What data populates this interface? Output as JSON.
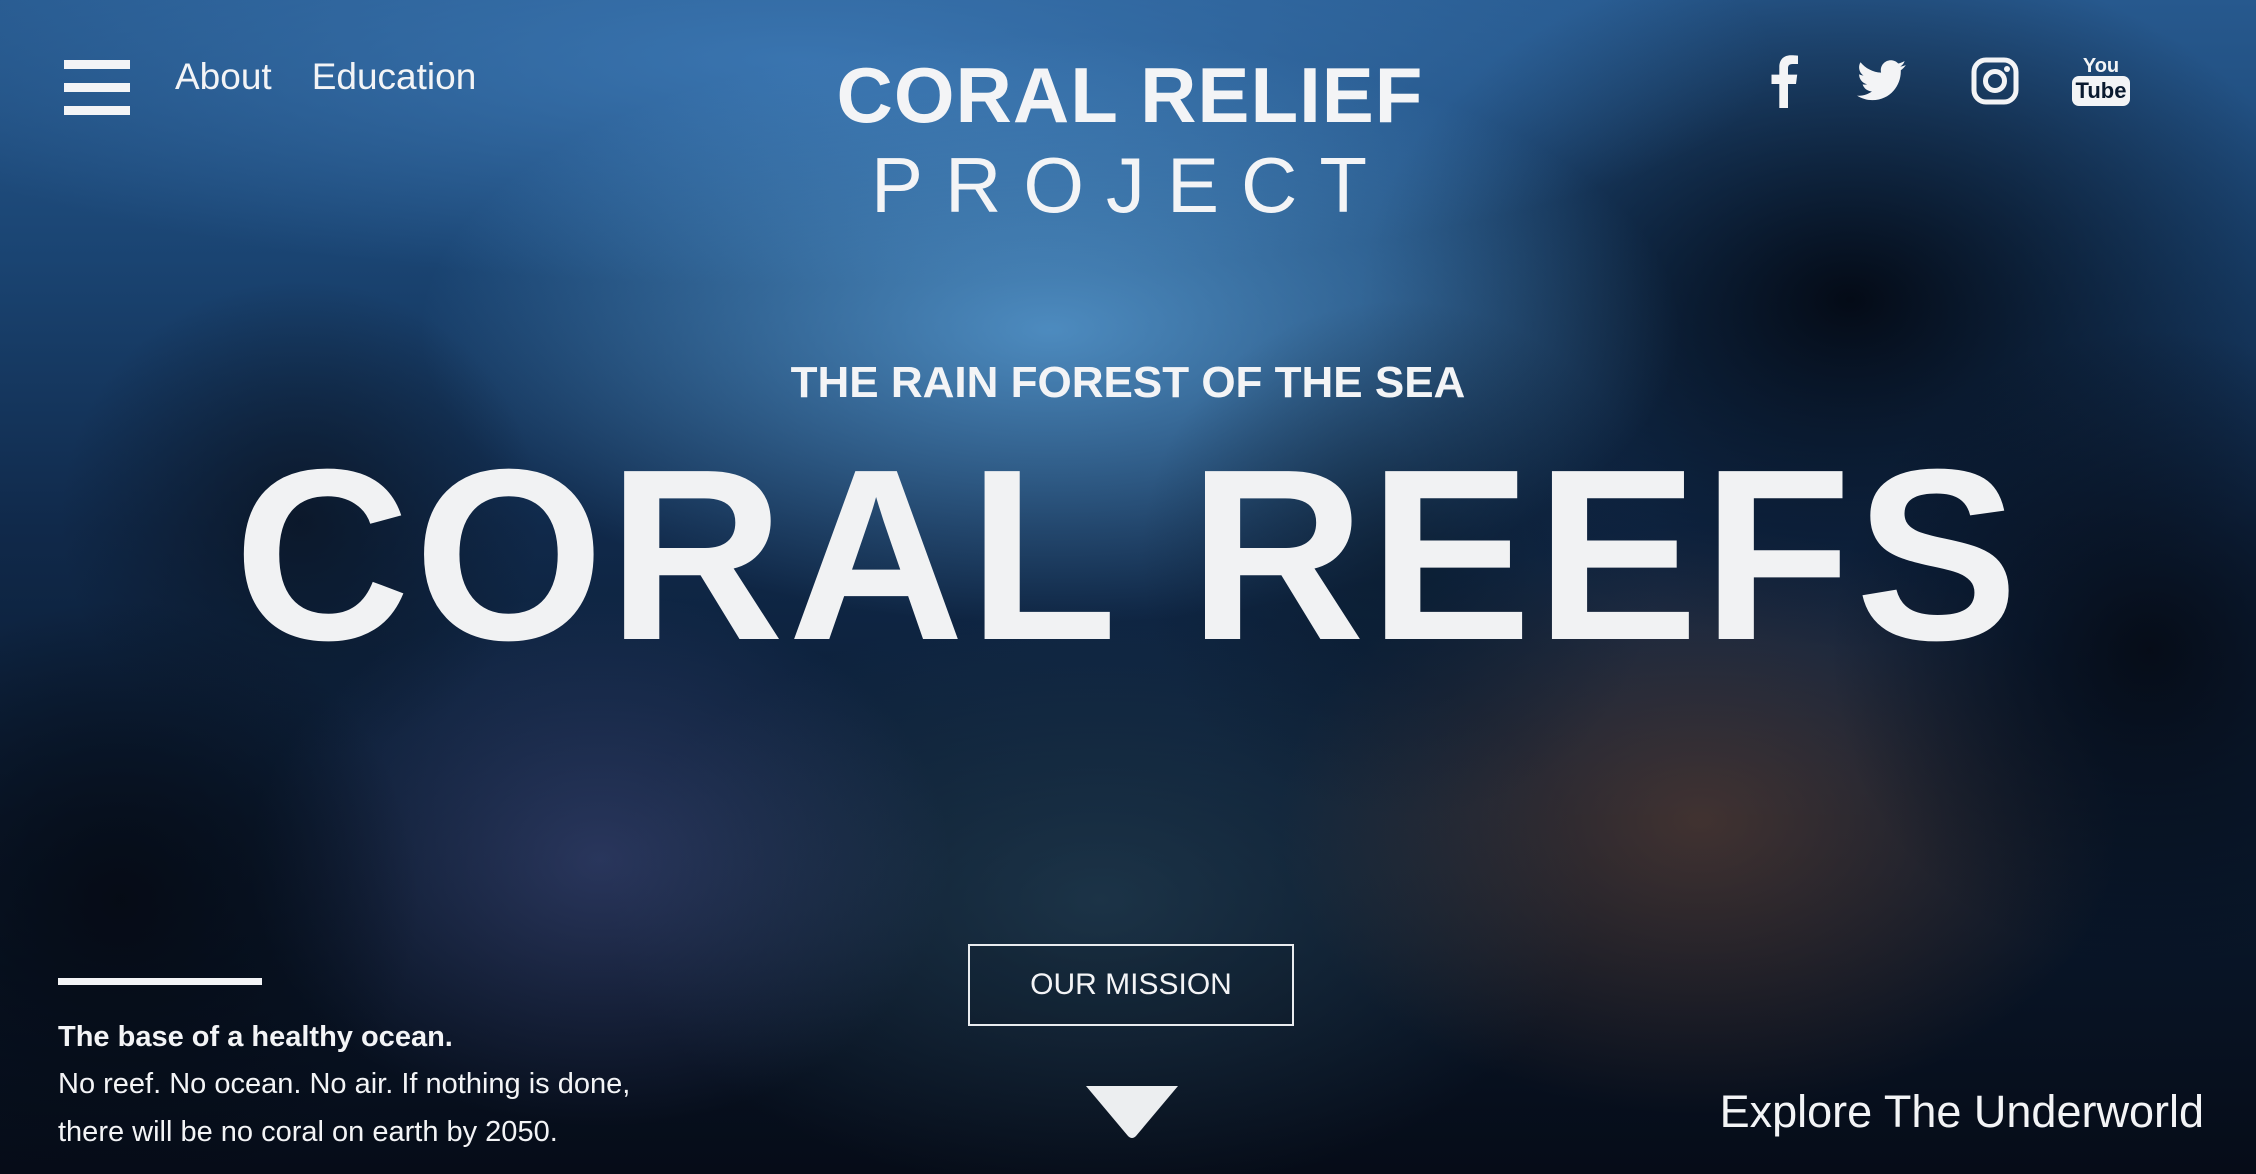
{
  "header": {
    "menu_icon": "hamburger-menu-icon",
    "nav": [
      {
        "label": "About"
      },
      {
        "label": "Education"
      }
    ],
    "logo": {
      "line1": "CORAL RELIEF",
      "line2": "PROJECT"
    },
    "social": [
      {
        "icon": "facebook-icon"
      },
      {
        "icon": "twitter-icon"
      },
      {
        "icon": "instagram-icon"
      },
      {
        "icon": "youtube-icon",
        "label_top": "You",
        "label_bottom": "Tube"
      }
    ]
  },
  "hero": {
    "subtitle": "THE RAIN FOREST OF THE SEA",
    "title": "CORAL REEFS",
    "cta_label": "OUR MISSION",
    "scroll_icon": "down-triangle-icon"
  },
  "footer_left": {
    "headline": "The base of a healthy ocean.",
    "body": "No reef. No ocean. No air. If nothing is done,\nthere will be no coral on earth by 2050."
  },
  "footer_right": {
    "link_label": "Explore The Underworld"
  },
  "colors": {
    "text": "#f3f4f6",
    "ocean_top": "#27598e",
    "ocean_deep": "#060c18"
  }
}
